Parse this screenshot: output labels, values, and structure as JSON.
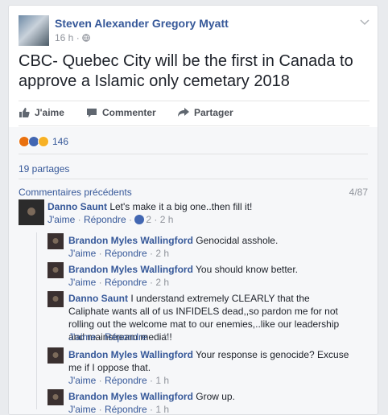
{
  "post": {
    "author": "Steven Alexander Gregory Myatt",
    "time": "16 h",
    "separator": "·",
    "text": "CBC- Quebec City will be the first in Canada to approve a Islamic only cemetary 2018"
  },
  "actions": {
    "like": "J'aime",
    "comment": "Commenter",
    "share": "Partager"
  },
  "reactions": {
    "count": "146",
    "icons": [
      "angry-reaction-icon",
      "like-reaction-icon",
      "sad-reaction-icon"
    ]
  },
  "shares": "19 partages",
  "comments_header": {
    "previous": "Commentaires précédents",
    "counter": "4/87"
  },
  "comments": [
    {
      "name": "Danno Saunt",
      "text": " Let's make it a big one..then fill it!",
      "like": "J'aime",
      "reply": "Répondre",
      "likes": "2",
      "time": "2 h"
    }
  ],
  "replies": [
    {
      "name": "Brandon Myles Wallingford",
      "text": " Genocidal asshole.",
      "like": "J'aime",
      "reply": "Répondre",
      "time": "2 h"
    },
    {
      "name": "Brandon Myles Wallingford",
      "text": " You should know better.",
      "like": "J'aime",
      "reply": "Répondre",
      "time": "2 h"
    },
    {
      "name": "Danno Saunt",
      "text": " I understand extremely CLEARLY that the Caliphate wants all of us INFIDELS dead,,so pardon me for not rolling out the welcome mat to our enemies,..like our leadership and mainstream media!!",
      "like": "J'aime",
      "reply": "Répondre",
      "time": "1 h"
    },
    {
      "name": "Brandon Myles Wallingford",
      "text": " Your response is genocide? Excuse me if I oppose that.",
      "like": "J'aime",
      "reply": "Répondre",
      "time": "1 h"
    },
    {
      "name": "Brandon Myles Wallingford",
      "text": " Grow up.",
      "like": "J'aime",
      "reply": "Répondre",
      "time": "1 h"
    }
  ],
  "colors": {
    "link": "#365899",
    "muted": "#90949c",
    "background": "#e9ebee"
  }
}
